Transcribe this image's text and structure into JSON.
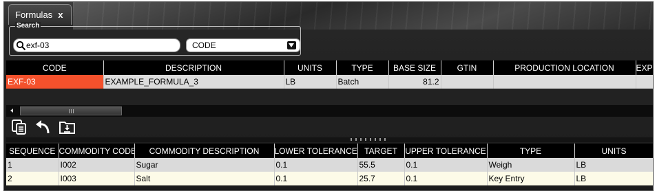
{
  "tab": {
    "label": "Formulas",
    "close_label": "x"
  },
  "search": {
    "legend": "Search",
    "value": "exf-03",
    "field_select": "CODE"
  },
  "formulas_table": {
    "columns": [
      "CODE",
      "DESCRIPTION",
      "UNITS",
      "TYPE",
      "BASE SIZE",
      "GTIN",
      "PRODUCTION LOCATION",
      "EXPIR"
    ],
    "rows": [
      {
        "code": "EXF-03",
        "description": "EXAMPLE_FORMULA_3",
        "units": "LB",
        "type": "Batch",
        "base_size": "81.2",
        "gtin": "",
        "production_location": "",
        "expir": ""
      }
    ]
  },
  "toolbar": {
    "icons": [
      "copy-document-icon",
      "undo-icon",
      "download-folder-icon"
    ]
  },
  "commodities_table": {
    "columns": [
      "SEQUENCE",
      "COMMODITY CODE",
      "COMMODITY DESCRIPTION",
      "LOWER TOLERANCE",
      "TARGET",
      "UPPER TOLERANCE",
      "TYPE",
      "UNITS"
    ],
    "rows": [
      {
        "sequence": "1",
        "commodity_code": "I002",
        "description": "Sugar",
        "lower": "0.1",
        "target": "55.5",
        "upper": "0.1",
        "type": "Weigh",
        "units": "LB"
      },
      {
        "sequence": "2",
        "commodity_code": "I003",
        "description": "Salt",
        "lower": "0.1",
        "target": "25.7",
        "upper": "0.1",
        "type": "Key Entry",
        "units": "LB"
      }
    ]
  },
  "colors": {
    "selected_cell": "#f4512c",
    "header_bg": "#000000",
    "row_alt": "#fdfbe8",
    "row_base": "#dadada"
  }
}
